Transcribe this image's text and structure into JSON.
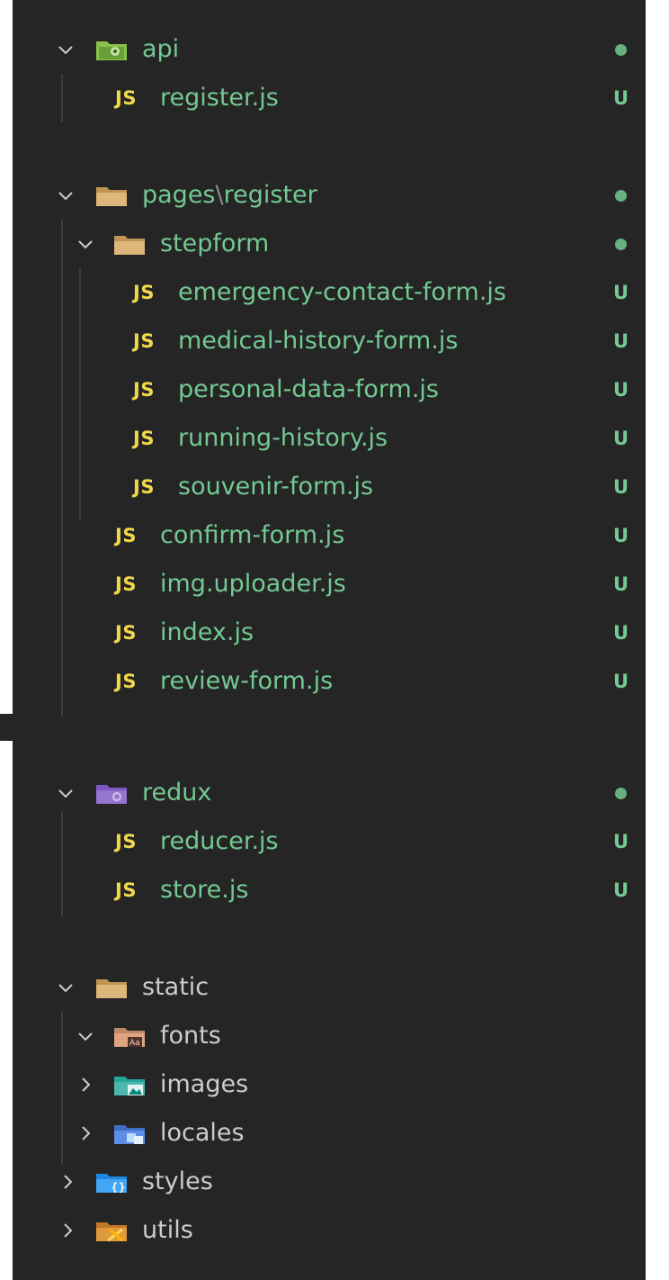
{
  "explorer": {
    "colors": {
      "background": "#252526",
      "untracked_green": "#73c991",
      "js_yellow": "#f1d84b",
      "default_text": "#cccccc"
    },
    "rows": [
      {
        "id": "api",
        "type": "folder",
        "expanded": true,
        "icon": "folder-api-icon",
        "label": "api",
        "status": "dot"
      },
      {
        "id": "register-js",
        "type": "file",
        "icon": "js-file-icon",
        "label": "register.js",
        "status": "U"
      },
      {
        "id": "pages-register",
        "type": "folder",
        "expanded": true,
        "icon": "folder-icon",
        "label_parts": [
          "pages",
          "\\",
          "register"
        ],
        "status": "dot"
      },
      {
        "id": "stepform",
        "type": "folder",
        "expanded": true,
        "icon": "folder-icon",
        "label": "stepform",
        "status": "dot"
      },
      {
        "id": "emergency-contact-form",
        "type": "file",
        "icon": "js-file-icon",
        "label": "emergency-contact-form.js",
        "status": "U"
      },
      {
        "id": "medical-history-form",
        "type": "file",
        "icon": "js-file-icon",
        "label": "medical-history-form.js",
        "status": "U"
      },
      {
        "id": "personal-data-form",
        "type": "file",
        "icon": "js-file-icon",
        "label": "personal-data-form.js",
        "status": "U"
      },
      {
        "id": "running-history",
        "type": "file",
        "icon": "js-file-icon",
        "label": "running-history.js",
        "status": "U"
      },
      {
        "id": "souvenir-form",
        "type": "file",
        "icon": "js-file-icon",
        "label": "souvenir-form.js",
        "status": "U"
      },
      {
        "id": "confirm-form",
        "type": "file",
        "icon": "js-file-icon",
        "label": "confirm-form.js",
        "status": "U"
      },
      {
        "id": "img-uploader",
        "type": "file",
        "icon": "js-file-icon",
        "label": "img.uploader.js",
        "status": "U"
      },
      {
        "id": "index",
        "type": "file",
        "icon": "js-file-icon",
        "label": "index.js",
        "status": "U"
      },
      {
        "id": "review-form",
        "type": "file",
        "icon": "js-file-icon",
        "label": "review-form.js",
        "status": "U"
      },
      {
        "id": "redux",
        "type": "folder",
        "expanded": true,
        "icon": "folder-redux-icon",
        "label": "redux",
        "status": "dot"
      },
      {
        "id": "reducer",
        "type": "file",
        "icon": "js-file-icon",
        "label": "reducer.js",
        "status": "U"
      },
      {
        "id": "store",
        "type": "file",
        "icon": "js-file-icon",
        "label": "store.js",
        "status": "U"
      },
      {
        "id": "static",
        "type": "folder",
        "expanded": true,
        "icon": "folder-icon",
        "label": "static",
        "status": ""
      },
      {
        "id": "fonts",
        "type": "folder",
        "expanded": true,
        "icon": "folder-fonts-icon",
        "label": "fonts",
        "status": ""
      },
      {
        "id": "images",
        "type": "folder",
        "expanded": false,
        "icon": "folder-images-icon",
        "label": "images",
        "status": ""
      },
      {
        "id": "locales",
        "type": "folder",
        "expanded": false,
        "icon": "folder-locales-icon",
        "label": "locales",
        "status": ""
      },
      {
        "id": "styles",
        "type": "folder",
        "expanded": false,
        "icon": "folder-styles-icon",
        "label": "styles",
        "status": ""
      },
      {
        "id": "utils",
        "type": "folder",
        "expanded": false,
        "icon": "folder-utils-icon",
        "label": "utils",
        "status": ""
      }
    ],
    "js_badge": "JS",
    "untracked_marker": "U"
  }
}
